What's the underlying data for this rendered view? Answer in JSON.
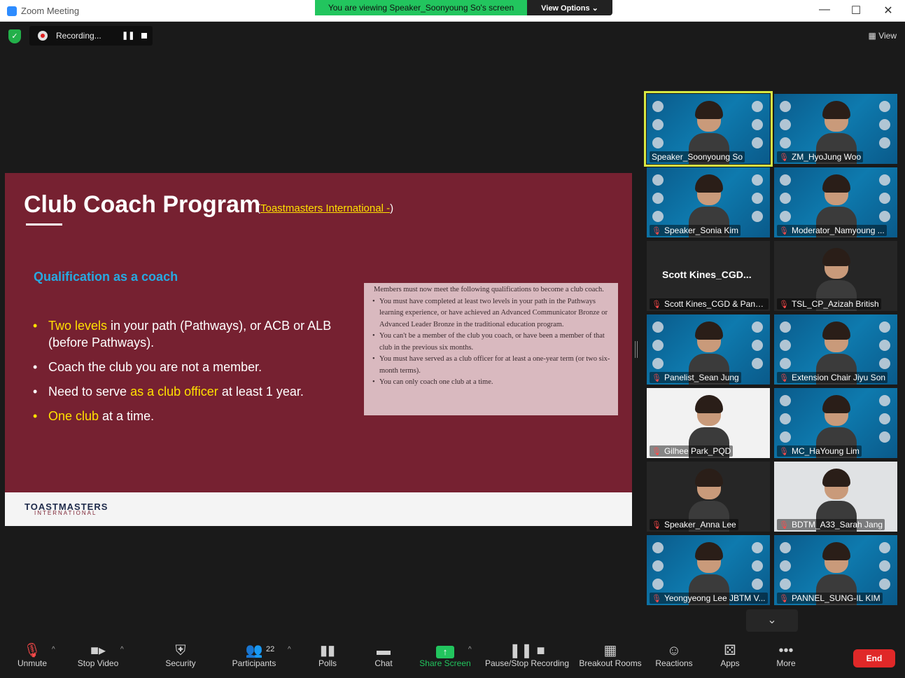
{
  "window": {
    "title": "Zoom Meeting",
    "minimize": "—",
    "maximize": "☐",
    "close": "✕"
  },
  "banner": {
    "viewing": "You are viewing Speaker_Soonyoung So's screen",
    "view_options": "View Options ⌄"
  },
  "recording": {
    "label": "Recording...",
    "pause": "❚❚"
  },
  "view_button": "▦ View",
  "slide": {
    "title": "Club Coach Program",
    "link_open": "(",
    "link": "Toastmasters International -",
    "link_close": ")",
    "subheading": "Qualification as a coach",
    "bullets": [
      {
        "parts": [
          {
            "t": "Two levels",
            "h": true
          },
          {
            "t": " in your path (Pathways), or ACB or ALB (before Pathways).",
            "h": false
          }
        ],
        "yellow_bullet": true
      },
      {
        "parts": [
          {
            "t": "Coach the club you are not a member.",
            "h": false
          }
        ],
        "yellow_bullet": false
      },
      {
        "parts": [
          {
            "t": "Need to serve ",
            "h": false
          },
          {
            "t": "as a club officer",
            "h": true
          },
          {
            "t": " at least 1 year.",
            "h": false
          }
        ],
        "yellow_bullet": false
      },
      {
        "parts": [
          {
            "t": "One club",
            "h": true
          },
          {
            "t": " at a time.",
            "h": false
          }
        ],
        "yellow_bullet": true
      }
    ],
    "box_intro": "Members must now meet the following qualifications to become a club coach.",
    "box_items": [
      "You must have completed at least two levels in your path in the Pathways learning experience, or have achieved an Advanced Communicator Bronze or Advanced Leader Bronze in the traditional education program.",
      "You can't be a member of the club you coach, or have been a member of that club in the previous six months.",
      "You must have served as a club officer for at least a one-year term (or two six-month terms).",
      "You can only coach one club at a time."
    ],
    "footer_logo": "TOASTMASTERS",
    "footer_sub": "INTERNATIONAL"
  },
  "participants_grid": [
    {
      "name": "Speaker_Soonyoung So",
      "muted": false,
      "bg": "blue",
      "active": true
    },
    {
      "name": "ZM_HyoJung Woo",
      "muted": true,
      "bg": "blue",
      "active": false
    },
    {
      "name": "Speaker_Sonia Kim",
      "muted": true,
      "bg": "blue",
      "active": false
    },
    {
      "name": "Moderator_Namyoung ...",
      "muted": true,
      "bg": "blue",
      "active": false
    },
    {
      "name": "Scott Kines_CGD & Pane...",
      "muted": true,
      "bg": "dark",
      "active": false,
      "display": "Scott  Kines_CGD..."
    },
    {
      "name": "TSL_CP_Azizah British",
      "muted": true,
      "bg": "dark",
      "active": false
    },
    {
      "name": "Panelist_Sean Jung",
      "muted": true,
      "bg": "blue",
      "active": false
    },
    {
      "name": "Extension Chair Jiyu Son",
      "muted": true,
      "bg": "blue",
      "active": false
    },
    {
      "name": "Gilhee Park_PQD",
      "muted": true,
      "bg": "dec",
      "active": false
    },
    {
      "name": "MC_HaYoung Lim",
      "muted": true,
      "bg": "blue",
      "active": false
    },
    {
      "name": "Speaker_Anna Lee",
      "muted": true,
      "bg": "dark",
      "active": false
    },
    {
      "name": "BDTM_A33_Sarah Jang",
      "muted": true,
      "bg": "wall",
      "active": false
    },
    {
      "name": "Yeongyeong Lee JBTM V...",
      "muted": true,
      "bg": "blue",
      "active": false
    },
    {
      "name": "PANNEL_SUNG-IL KIM",
      "muted": true,
      "bg": "blue",
      "active": false
    }
  ],
  "expand_label": "⌄",
  "toolbar": {
    "unmute": "Unmute",
    "stop_video": "Stop Video",
    "security": "Security",
    "participants": "Participants",
    "participants_count": "22",
    "polls": "Polls",
    "chat": "Chat",
    "share_screen": "Share Screen",
    "pause_stop_recording": "Pause/Stop Recording",
    "breakout_rooms": "Breakout Rooms",
    "reactions": "Reactions",
    "apps": "Apps",
    "more": "More",
    "end": "End"
  },
  "colors": {
    "accent_green": "#22c55e",
    "slide_bg": "#762131",
    "highlight": "#ffe000",
    "end_red": "#e02828"
  }
}
